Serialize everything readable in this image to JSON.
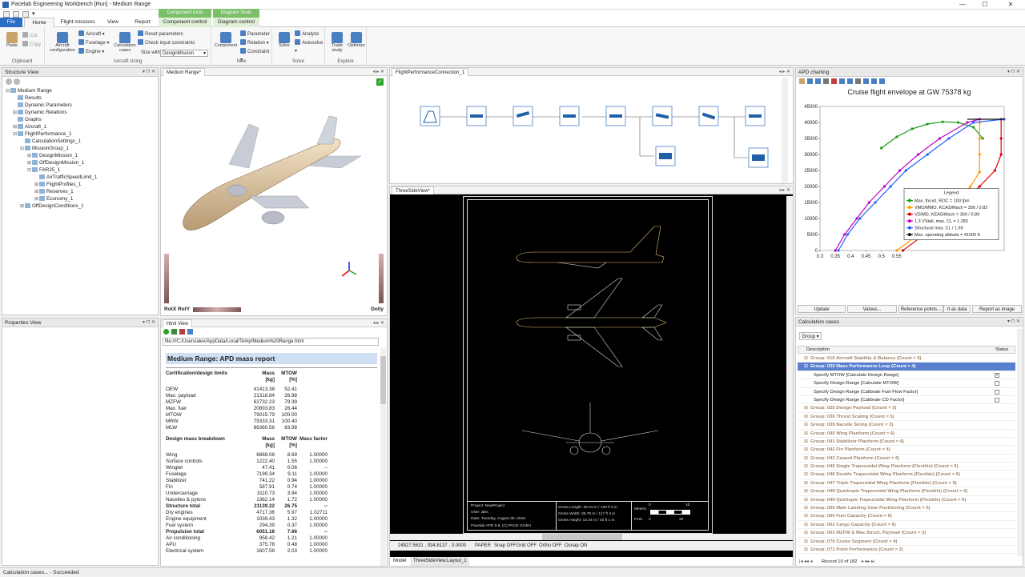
{
  "window": {
    "title": "Pacelab Engineering Workbench [Run] - Medium Range"
  },
  "tabs": [
    "File",
    "Home",
    "Flight missions",
    "View",
    "Report",
    "Component control",
    "Diagram control"
  ],
  "context_tabs": [
    "Component tools",
    "Diagram Tools"
  ],
  "ribbon": {
    "clipboard": {
      "label": "Clipboard",
      "paste": "Paste",
      "cut": "Cut",
      "copy": "Copy"
    },
    "aircraft_sizing": {
      "label": "Aircraft sizing",
      "aircraft_config": "Aircraft configuration",
      "aircraft": "Aircraft",
      "fuselage": "Fuselage",
      "engine": "Engine",
      "calc_cases": "Calculation cases",
      "reset": "Reset parameters",
      "check": "Check input constraints",
      "size_with": "Size with",
      "size_value": "DesignMission"
    },
    "new": {
      "label": "New",
      "component": "Component",
      "parameter": "Parameter",
      "relation": "Relation",
      "constraint": "Constraint"
    },
    "solve": {
      "label": "Solve",
      "solve": "Solve",
      "analyze": "Analyze",
      "autosolve": "Autosolve"
    },
    "explore": {
      "label": "Explore",
      "trade": "Trade study",
      "optimize": "Optimize"
    }
  },
  "structure": {
    "title": "Structure View",
    "items": [
      {
        "label": "Medium Range",
        "level": 0,
        "tw": "⊟"
      },
      {
        "label": "Results",
        "level": 1,
        "tw": ""
      },
      {
        "label": "Dynamic Parameters",
        "level": 1,
        "tw": ""
      },
      {
        "label": "Dynamic Relations",
        "level": 1,
        "tw": "⊞"
      },
      {
        "label": "Graphs",
        "level": 1,
        "tw": ""
      },
      {
        "label": "Aircraft_1",
        "level": 1,
        "tw": "⊞"
      },
      {
        "label": "FlightPerformance_1",
        "level": 1,
        "tw": "⊟"
      },
      {
        "label": "CalculationSettings_1",
        "level": 2,
        "tw": ""
      },
      {
        "label": "MissionGroup_1",
        "level": 2,
        "tw": "⊟"
      },
      {
        "label": "DesignMission_1",
        "level": 3,
        "tw": "⊞"
      },
      {
        "label": "OffDesignMission_1",
        "level": 3,
        "tw": "⊞"
      },
      {
        "label": "FAR25_1",
        "level": 3,
        "tw": "⊟"
      },
      {
        "label": "AirTrafficSpeedLimit_1",
        "level": 4,
        "tw": ""
      },
      {
        "label": "FlightProfiles_1",
        "level": 4,
        "tw": "⊞"
      },
      {
        "label": "Reserves_1",
        "level": 4,
        "tw": "⊞"
      },
      {
        "label": "Economy_1",
        "level": 4,
        "tw": "⊞"
      },
      {
        "label": "OffDesignConditions_1",
        "level": 2,
        "tw": "⊞"
      }
    ]
  },
  "properties": {
    "title": "Properties View"
  },
  "view3d": {
    "tab": "Medium Range*",
    "rot": "RotX RotY",
    "dolly": "Dolly"
  },
  "html": {
    "tab": "Html View",
    "url": "file:///C:/Users/alex/AppData/Local/Temp/Medium%20Range.html",
    "heading": "Medium Range: APD mass report",
    "limits_title": "Certification/design limits",
    "mass_h": "Mass",
    "mass_u": "[kg]",
    "mtow_h": "MTOW",
    "mtow_u": "[%]",
    "mf_h": "Mass factor",
    "limits": [
      [
        "OEW",
        "41413.38",
        "52.41"
      ],
      [
        "Max. payload",
        "21318.84",
        "26.98"
      ],
      [
        "MZFW",
        "62732.23",
        "79.39"
      ],
      [
        "Max. fuel",
        "20893.83",
        "26.44"
      ],
      [
        "MTOW",
        "79015.79",
        "100.00"
      ],
      [
        "MRW",
        "79333.31",
        "100.40"
      ],
      [
        "MLW",
        "66360.56",
        "83.98"
      ]
    ],
    "breakdown_title": "Design mass breakdown",
    "breakdown": [
      [
        "Wing",
        "6868.08",
        "8.69",
        "1.00000",
        false
      ],
      [
        "Surface controls",
        "1222.40",
        "1.55",
        "1.00000",
        false
      ],
      [
        "Winglet",
        "47.41",
        "0.06",
        "--",
        false
      ],
      [
        "Fuselage",
        "7199.34",
        "9.11",
        "1.00000",
        false
      ],
      [
        "Stabilizer",
        "741.22",
        "0.94",
        "1.00000",
        false
      ],
      [
        "Fin",
        "587.91",
        "0.74",
        "1.00000",
        false
      ],
      [
        "Undercarriage",
        "3110.73",
        "3.94",
        "1.00000",
        false
      ],
      [
        "Nacelles & pylons",
        "1362.14",
        "1.72",
        "1.00000",
        false
      ],
      [
        "Structure total",
        "21139.22",
        "26.75",
        "--",
        true
      ],
      [
        "Dry engines",
        "4717.36",
        "5.97",
        "1.02711",
        false
      ],
      [
        "Engine equipment",
        "1039.43",
        "1.32",
        "1.00000",
        false
      ],
      [
        "Fuel system",
        "294.39",
        "0.37",
        "1.00000",
        false
      ],
      [
        "Propulsion total",
        "6051.18",
        "7.66",
        "--",
        true
      ],
      [
        "Air conditioning",
        "958.42",
        "1.21",
        "1.00000",
        false
      ],
      [
        "APU",
        "375.78",
        "0.48",
        "1.00000",
        false
      ],
      [
        "Electrical system",
        "1607.58",
        "2.03",
        "1.00000",
        false
      ]
    ]
  },
  "flow": {
    "tab": "FlightPerformanceConnection_1"
  },
  "three": {
    "tab": "ThreeSideView*",
    "tb": {
      "project_k": "Project:",
      "project_v": "NewProject",
      "user_k": "User:",
      "user_v": "alex",
      "date_k": "Date:",
      "date_v": "Tuesday, August 30, 2016",
      "copy": "Pacelab APD 8.6, (C) PACE GmbH",
      "gl": "Gross Length:",
      "gl_v": "39.33 m / 129 ft 0 in",
      "gw": "Gross Width:",
      "gw_v": "35.78 m / 117 ft 4 in",
      "gh": "Gross Height:",
      "gh_v": "12.24 m / 40 ft 1 in",
      "meters": "Meters:",
      "feet": "Feet:",
      "m0": "0",
      "m10": "10",
      "f0": "0",
      "f30": "30"
    },
    "coords": "24827.5631 , 934.8137 , 0.0000",
    "modes": [
      "PAPER",
      "Snap OFF",
      "Grid OFF",
      "Ortho OFF",
      "Osnap ON"
    ],
    "bottom_tabs": [
      "Model",
      "ThreeSideView.Layout_1"
    ]
  },
  "apd": {
    "title": "APD charting",
    "chart_title": "Cruise flight envelope at GW 75378 kg",
    "buttons": [
      "Update",
      "Values...",
      "Reference points...",
      "rt as data",
      "Report as image"
    ]
  },
  "chart_data": {
    "type": "line",
    "title": "Cruise flight envelope at GW 75378 kg",
    "xlim": [
      0.3,
      0.9
    ],
    "ylim": [
      0,
      45000
    ],
    "xticks": [
      "0.3",
      "0.35",
      "0.4",
      "0.45",
      "0.5",
      "0.55"
    ],
    "yticks": [
      "0",
      "5000",
      "10000",
      "15000",
      "20000",
      "25000",
      "30000",
      "35000",
      "40000",
      "45000"
    ],
    "legend_title": "Legend",
    "series": [
      {
        "name": "Max. thrust, ROC = 100 fpm",
        "color": "#1a9a1a",
        "points": [
          [
            0.5,
            32000
          ],
          [
            0.55,
            35500
          ],
          [
            0.6,
            38000
          ],
          [
            0.65,
            39500
          ],
          [
            0.7,
            40200
          ],
          [
            0.75,
            40000
          ],
          [
            0.8,
            38500
          ],
          [
            0.83,
            35000
          ]
        ]
      },
      {
        "name": "VMO/MMO, KCAS/Mach = 356 / 0.82",
        "color": "#ff9900",
        "points": [
          [
            0.55,
            0
          ],
          [
            0.62,
            5000
          ],
          [
            0.68,
            10000
          ],
          [
            0.74,
            15000
          ],
          [
            0.79,
            20000
          ],
          [
            0.82,
            24500
          ],
          [
            0.82,
            30000
          ],
          [
            0.82,
            35000
          ],
          [
            0.82,
            40000
          ]
        ]
      },
      {
        "name": "VD/MD, KEAS/Mach = 369 / 0.89",
        "color": "#e00000",
        "points": [
          [
            0.57,
            0
          ],
          [
            0.64,
            5000
          ],
          [
            0.7,
            10000
          ],
          [
            0.76,
            15000
          ],
          [
            0.82,
            20000
          ],
          [
            0.87,
            25000
          ],
          [
            0.89,
            30000
          ],
          [
            0.89,
            35000
          ],
          [
            0.89,
            41000
          ]
        ]
      },
      {
        "name": "1.3 VStall, max. CL = 1.282",
        "color": "#c000c0",
        "points": [
          [
            0.35,
            0
          ],
          [
            0.38,
            5000
          ],
          [
            0.42,
            10000
          ],
          [
            0.46,
            15000
          ],
          [
            0.51,
            20000
          ],
          [
            0.56,
            25000
          ],
          [
            0.62,
            30000
          ],
          [
            0.69,
            35000
          ],
          [
            0.78,
            40000
          ],
          [
            0.82,
            41000
          ]
        ]
      },
      {
        "name": "Structural max. CL / 1.69",
        "color": "#2060ff",
        "points": [
          [
            0.36,
            0
          ],
          [
            0.39,
            5000
          ],
          [
            0.43,
            10000
          ],
          [
            0.48,
            15000
          ],
          [
            0.53,
            20000
          ],
          [
            0.58,
            25000
          ],
          [
            0.65,
            30000
          ],
          [
            0.72,
            35000
          ],
          [
            0.8,
            40000
          ],
          [
            0.9,
            41000
          ]
        ]
      },
      {
        "name": "Max. operating altitude = 41000 ft",
        "color": "#111111",
        "points": [
          [
            0.78,
            41000
          ],
          [
            0.9,
            41000
          ]
        ]
      }
    ]
  },
  "calc": {
    "title": "Calculation cases",
    "group_btn": "Group",
    "col_desc": "Description",
    "col_status": "Status",
    "rows": [
      {
        "t": "g",
        "label": "Group: 010 Aircraft Stability & Balance (Count = 9)"
      },
      {
        "t": "s",
        "label": "Group: 020 Mass Performance Loop (Count = 4)"
      },
      {
        "t": "i",
        "label": "Specify MTOW [Calculate Design Range]",
        "c": true
      },
      {
        "t": "i",
        "label": "Specify Design Range [Calculate MTOW]",
        "c": false
      },
      {
        "t": "i",
        "label": "Specify Design Range [Calibrate Fuel Flow Factor]",
        "c": false
      },
      {
        "t": "i",
        "label": "Specify Design Range [Calibrate CD Factor]",
        "c": false
      },
      {
        "t": "g",
        "label": "Group: 025 Design Payload (Count = 3)"
      },
      {
        "t": "g",
        "label": "Group: 030 Thrust Scaling (Count = 5)"
      },
      {
        "t": "g",
        "label": "Group: 035 Nacelle Sizing (Count = 3)"
      },
      {
        "t": "g",
        "label": "Group: 040 Wing Planform (Count = 6)"
      },
      {
        "t": "g",
        "label": "Group: 041 Stabilizer Planform (Count = 4)"
      },
      {
        "t": "g",
        "label": "Group: 042 Fin Planform (Count = 4)"
      },
      {
        "t": "g",
        "label": "Group: 043 Canard Planform (Count = 4)"
      },
      {
        "t": "g",
        "label": "Group: 045 Single Trapezoidal Wing Planform (Flexible) (Count = 6)"
      },
      {
        "t": "g",
        "label": "Group: 046 Double Trapezoidal Wing Planform (Flexible) (Count = 6)"
      },
      {
        "t": "g",
        "label": "Group: 047 Triple Trapezoidal Wing Planform (Flexible) (Count = 6)"
      },
      {
        "t": "g",
        "label": "Group: 048 Quadruple Trapezoidal Wing Planform (Flexible) (Count = 6)"
      },
      {
        "t": "g",
        "label": "Group: 049 Quintuple Trapezoidal Wing Planform (Flexible) (Count = 6)"
      },
      {
        "t": "g",
        "label": "Group: 050 Main Landing Gear Positioning (Count = 6)"
      },
      {
        "t": "g",
        "label": "Group: 060 Fuel Capacity (Count = 6)"
      },
      {
        "t": "g",
        "label": "Group: 062 Cargo Capacity (Count = 6)"
      },
      {
        "t": "g",
        "label": "Group: 063 MZFW & Max Struct. Payload (Count = 3)"
      },
      {
        "t": "g",
        "label": "Group: 070 Cruise Segment (Count = 4)"
      },
      {
        "t": "g",
        "label": "Group: 071 Point Performance (Count = 2)"
      }
    ],
    "record": "Record 10 of 182"
  },
  "status": "Calculation cases... - Succeeded"
}
